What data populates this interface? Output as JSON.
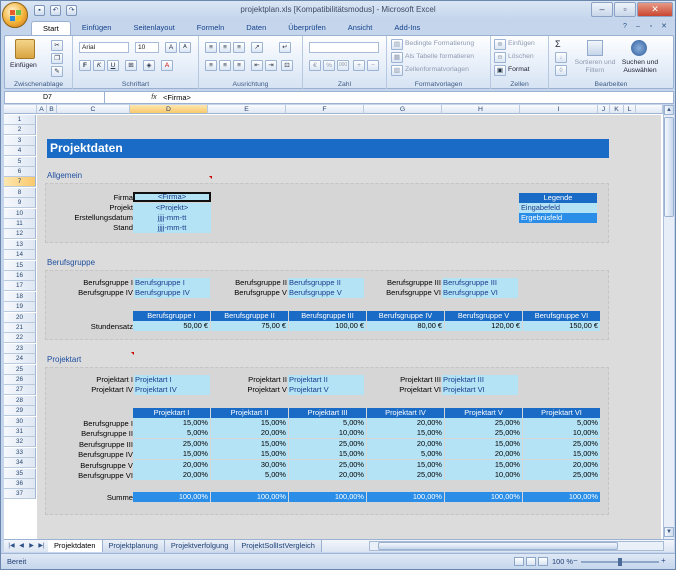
{
  "app": {
    "title": "projektplan.xls  [Kompatibilitätsmodus]  -  Microsoft Excel",
    "qat": [
      "save-icon",
      "undo-icon",
      "redo-icon"
    ],
    "win_ctrls": [
      "–",
      "▫",
      "✕"
    ],
    "ribbon_ctrls": [
      "?",
      "–",
      "▫",
      "✕"
    ]
  },
  "ribbon": {
    "tabs": [
      "Start",
      "Einfügen",
      "Seitenlayout",
      "Formeln",
      "Daten",
      "Überprüfen",
      "Ansicht",
      "Add-Ins"
    ],
    "groups": {
      "clipboard": {
        "label": "Zwischenablage",
        "paste": "Einfügen"
      },
      "font": {
        "label": "Schriftart",
        "font_name": "Arial",
        "font_size": "10",
        "bold": "F",
        "italic": "K",
        "underline": "U",
        "grow": "A",
        "shrink": "A"
      },
      "alignment": {
        "label": "Ausrichtung"
      },
      "number": {
        "label": "Zahl",
        "format": "%",
        "thousands": "000"
      },
      "styles": {
        "label": "Formatvorlagen",
        "conditional": "Bedingte Formatierung",
        "as_table": "Als Tabelle formatieren",
        "cell_styles": "Zellenformatvorlagen"
      },
      "cells": {
        "label": "Zellen",
        "insert": "Einfügen",
        "delete": "Löschen",
        "format": "Format"
      },
      "editing": {
        "label": "Bearbeiten",
        "sigma": "Σ",
        "sort": "Sortieren und Filtern",
        "find": "Suchen und Auswählen"
      }
    }
  },
  "formula_bar": {
    "name_box": "D7",
    "fx": "fx",
    "content": "<Firma>"
  },
  "grid": {
    "columns": [
      "A",
      "B",
      "C",
      "D",
      "E",
      "F",
      "G",
      "H",
      "I",
      "J",
      "K",
      "L"
    ],
    "rows": [
      "1",
      "2",
      "3",
      "4",
      "5",
      "6",
      "7",
      "8",
      "9",
      "10",
      "11",
      "12",
      "13",
      "14",
      "15",
      "16",
      "17",
      "18",
      "19",
      "20",
      "21",
      "22",
      "23",
      "24",
      "25",
      "26",
      "27",
      "28",
      "29",
      "30",
      "31",
      "32",
      "33",
      "34",
      "35",
      "36",
      "37"
    ],
    "selected_col": "D",
    "selected_row": "7"
  },
  "sheet": {
    "banner": "Projektdaten",
    "allgemein": {
      "title": "Allgemein",
      "fields": [
        {
          "label": "Firma",
          "value": "<Firma>"
        },
        {
          "label": "Projekt",
          "value": "<Projekt>"
        },
        {
          "label": "Erstellungsdatum",
          "value": "jjjj-mm-tt"
        },
        {
          "label": "Stand",
          "value": "jjjj-mm-tt"
        }
      ]
    },
    "legend": {
      "title": "Legende",
      "input": "Eingabefeld",
      "output": "Ergebnisfeld"
    },
    "berufsgruppe": {
      "title": "Berufsgruppe",
      "pairs": [
        {
          "label": "Berufsgruppe I",
          "value": "Berufsgruppe I"
        },
        {
          "label": "Berufsgruppe II",
          "value": "Berufsgruppe II"
        },
        {
          "label": "Berufsgruppe III",
          "value": "Berufsgruppe III"
        },
        {
          "label": "Berufsgruppe IV",
          "value": "Berufsgruppe IV"
        },
        {
          "label": "Berufsgruppe V",
          "value": "Berufsgruppe V"
        },
        {
          "label": "Berufsgruppe VI",
          "value": "Berufsgruppe VI"
        }
      ],
      "headers": [
        "Berufsgruppe I",
        "Berufsgruppe II",
        "Berufsgruppe III",
        "Berufsgruppe IV",
        "Berufsgruppe V",
        "Berufsgruppe VI"
      ],
      "rate_label": "Stundensatz",
      "rates": [
        "50,00 €",
        "75,00 €",
        "100,00 €",
        "80,00 €",
        "120,00 €",
        "150,00 €"
      ]
    },
    "projektart": {
      "title": "Projektart",
      "pairs": [
        {
          "label": "Projektart I",
          "value": "Projektart I"
        },
        {
          "label": "Projektart II",
          "value": "Projektart II"
        },
        {
          "label": "Projektart III",
          "value": "Projektart III"
        },
        {
          "label": "Projektart IV",
          "value": "Projektart IV"
        },
        {
          "label": "Projektart V",
          "value": "Projektart V"
        },
        {
          "label": "Projektart VI",
          "value": "Projektart VI"
        }
      ],
      "headers": [
        "Projektart I",
        "Projektart II",
        "Projektart III",
        "Projektart IV",
        "Projektart V",
        "Projektart VI"
      ],
      "rows": [
        {
          "label": "Berufsgruppe I",
          "values": [
            "15,00%",
            "15,00%",
            "5,00%",
            "20,00%",
            "25,00%",
            "5,00%"
          ]
        },
        {
          "label": "Berufsgruppe II",
          "values": [
            "5,00%",
            "20,00%",
            "10,00%",
            "15,00%",
            "25,00%",
            "10,00%"
          ]
        },
        {
          "label": "Berufsgruppe III",
          "values": [
            "25,00%",
            "15,00%",
            "25,00%",
            "20,00%",
            "15,00%",
            "25,00%"
          ]
        },
        {
          "label": "Berufsgruppe IV",
          "values": [
            "15,00%",
            "15,00%",
            "15,00%",
            "5,00%",
            "20,00%",
            "15,00%"
          ]
        },
        {
          "label": "Berufsgruppe V",
          "values": [
            "20,00%",
            "30,00%",
            "25,00%",
            "15,00%",
            "15,00%",
            "20,00%"
          ]
        },
        {
          "label": "Berufsgruppe VI",
          "values": [
            "20,00%",
            "5,00%",
            "20,00%",
            "25,00%",
            "10,00%",
            "25,00%"
          ]
        }
      ],
      "sum_label": "Summe",
      "sums": [
        "100,00%",
        "100,00%",
        "100,00%",
        "100,00%",
        "100,00%",
        "100,00%"
      ]
    }
  },
  "sheet_tabs": [
    "Projektdaten",
    "Projektplanung",
    "Projektverfolgung",
    "ProjektSollIstVergleich"
  ],
  "active_tab": "Projektdaten",
  "status": {
    "text": "Bereit",
    "zoom": "100 %"
  }
}
